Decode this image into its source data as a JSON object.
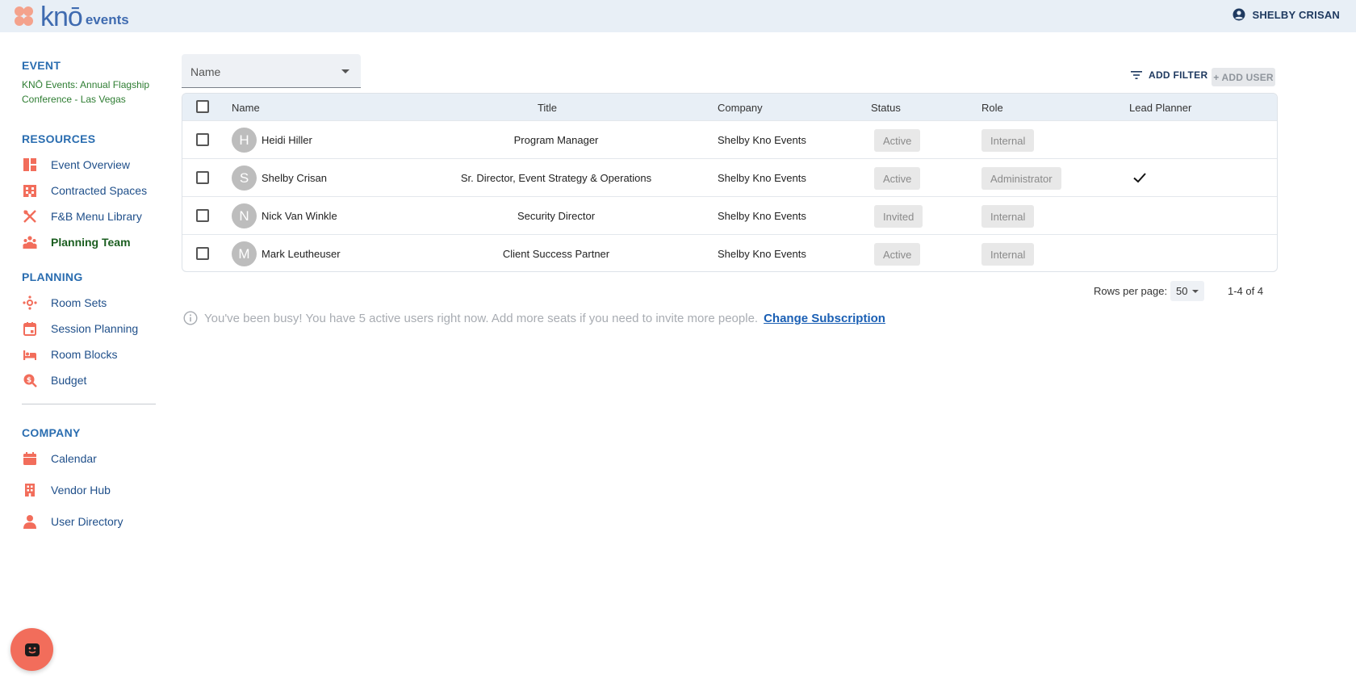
{
  "header": {
    "logo_text": "knō",
    "logo_suffix": "events",
    "user_name": "SHELBY CRISAN"
  },
  "sidebar": {
    "event_heading": "EVENT",
    "event_name": "KNŌ Events: Annual Flagship Conference - Las Vegas",
    "resources_heading": "RESOURCES",
    "resources": [
      {
        "label": "Event Overview",
        "icon": "dashboard-icon"
      },
      {
        "label": "Contracted Spaces",
        "icon": "building-icon"
      },
      {
        "label": "F&B Menu Library",
        "icon": "utensils-icon"
      },
      {
        "label": "Planning Team",
        "icon": "team-icon",
        "active": true
      }
    ],
    "planning_heading": "PLANNING",
    "planning": [
      {
        "label": "Room Sets",
        "icon": "room-sets-icon"
      },
      {
        "label": "Session Planning",
        "icon": "calendar-event-icon"
      },
      {
        "label": "Room Blocks",
        "icon": "bed-icon"
      },
      {
        "label": "Budget",
        "icon": "budget-icon"
      }
    ],
    "company_heading": "COMPANY",
    "company": [
      {
        "label": "Calendar",
        "icon": "calendar-icon"
      },
      {
        "label": "Vendor Hub",
        "icon": "vendor-building-icon"
      },
      {
        "label": "User Directory",
        "icon": "person-icon"
      }
    ]
  },
  "toolbar": {
    "name_select_value": "Name",
    "add_filter_label": "ADD FILTER",
    "add_user_label": "+ ADD USER"
  },
  "table": {
    "headers": {
      "name": "Name",
      "title": "Title",
      "company": "Company",
      "status": "Status",
      "role": "Role",
      "lead_planner": "Lead Planner"
    },
    "rows": [
      {
        "initial": "H",
        "name": "Heidi Hiller",
        "title": "Program Manager",
        "company": "Shelby Kno Events",
        "status": "Active",
        "role": "Internal",
        "lead_planner": false
      },
      {
        "initial": "S",
        "name": "Shelby Crisan",
        "title": "Sr. Director, Event Strategy & Operations",
        "company": "Shelby Kno Events",
        "status": "Active",
        "role": "Administrator",
        "lead_planner": true
      },
      {
        "initial": "N",
        "name": "Nick Van Winkle",
        "title": "Security Director",
        "company": "Shelby Kno Events",
        "status": "Invited",
        "role": "Internal",
        "lead_planner": false
      },
      {
        "initial": "M",
        "name": "Mark Leutheuser",
        "title": "Client Success Partner",
        "company": "Shelby Kno Events",
        "status": "Active",
        "role": "Internal",
        "lead_planner": false
      }
    ]
  },
  "pagination": {
    "rows_per_page_label": "Rows per page:",
    "rows_per_page_value": "50",
    "range": "1-4 of 4"
  },
  "notice": {
    "text": "You've been busy! You have 5 active users right now. Add more seats if you need to invite more people.",
    "link_label": "Change Subscription"
  },
  "colors": {
    "accent": "#f26d5b",
    "nav_text": "#1f4f8a",
    "header_bg": "#e8eff6"
  }
}
